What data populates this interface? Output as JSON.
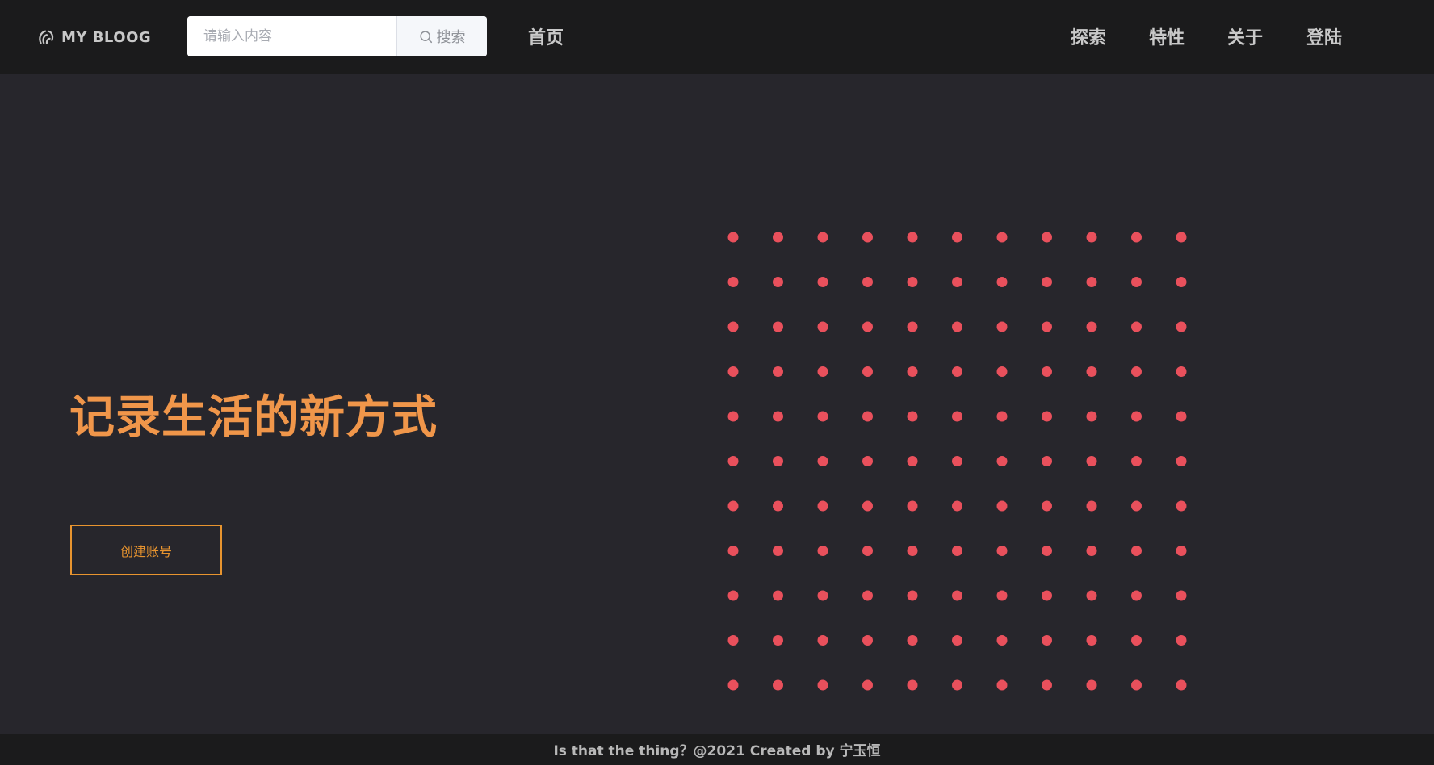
{
  "navbar": {
    "logo_text": "MY BLOOG",
    "logo_icon": "signal-swirl-icon",
    "search": {
      "placeholder": "请输入内容",
      "button_label": "搜索",
      "button_icon": "search-icon"
    },
    "home_label": "首页",
    "explore_label": "探索",
    "features_label": "特性",
    "about_label": "关于",
    "login_label": "登陆"
  },
  "hero": {
    "title": "记录生活的新方式",
    "cta_label": "创建账号",
    "title_color": "#f0964a",
    "cta_color": "#e8942f"
  },
  "decoration": {
    "dot_color": "#e9505c",
    "rows": 11,
    "cols": 11
  },
  "footer": {
    "text": "Is that the thing？@2021 Created by 宁玉恒"
  },
  "colors": {
    "background": "#27262c",
    "navbar": "#1b1b1c"
  }
}
